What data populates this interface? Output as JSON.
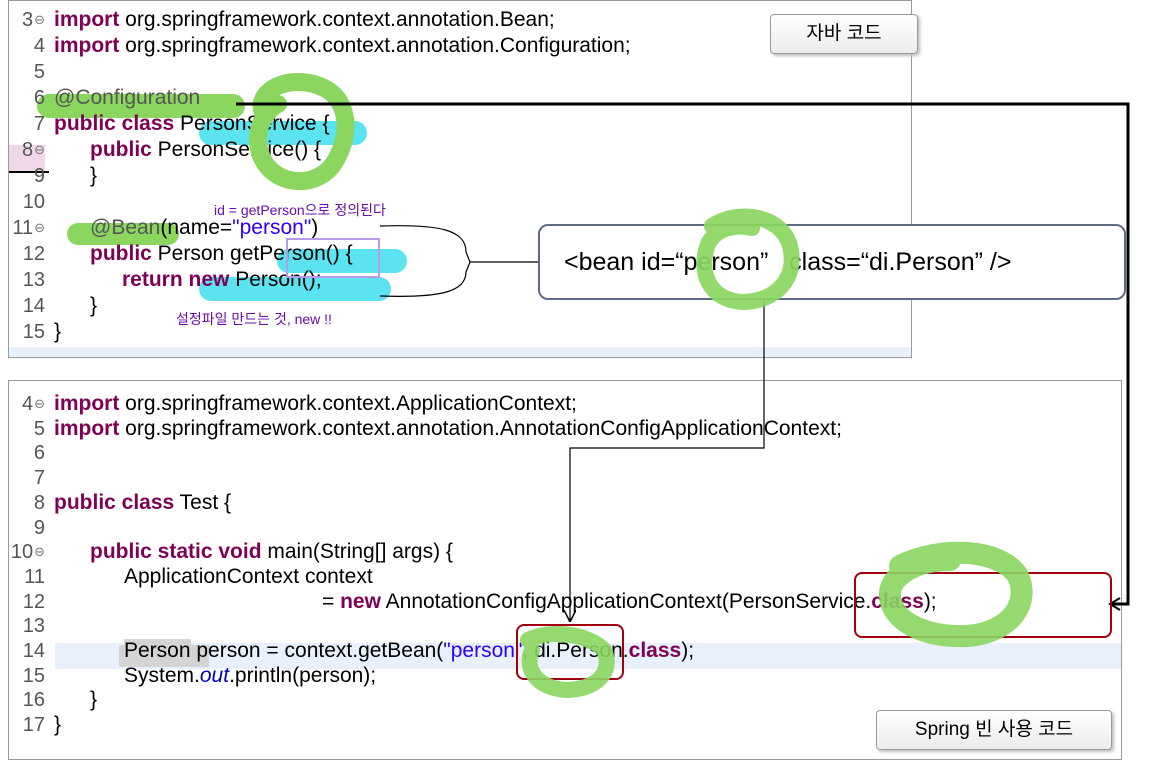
{
  "top_code": {
    "lines": [
      {
        "no": "3",
        "fold": true,
        "kw": "import",
        "rest": " org.springframework.context.annotation.Bean;"
      },
      {
        "no": "4",
        "fold": false,
        "kw": "import",
        "rest": " org.springframework.context.annotation.Configuration;"
      },
      {
        "no": "5",
        "fold": false
      },
      {
        "no": "6",
        "fold": false,
        "ann": "@Configuration"
      },
      {
        "no": "7",
        "fold": false,
        "kw": "public class",
        "rest": " PersonService {"
      },
      {
        "no": "8",
        "fold": true,
        "kw": "public",
        "rest": " PersonService() {"
      },
      {
        "no": "9",
        "fold": false,
        "rest": "}"
      },
      {
        "no": "10",
        "fold": false
      },
      {
        "no": "11",
        "fold": true,
        "ann": "@Bean",
        "rest": "(name=",
        "str": "\"person\"",
        "tail": ")"
      },
      {
        "no": "12",
        "fold": false,
        "kw": "public",
        "rest": " Person getPerson() {"
      },
      {
        "no": "13",
        "fold": false,
        "kw": "return new",
        "rest": " Person();"
      },
      {
        "no": "14",
        "fold": false,
        "rest": "}"
      },
      {
        "no": "15",
        "fold": false,
        "rest": "}"
      }
    ]
  },
  "bottom_code": {
    "lines": [
      {
        "no": "4",
        "fold": true,
        "kw": "import",
        "rest": " org.springframework.context.ApplicationContext;"
      },
      {
        "no": "5",
        "fold": false,
        "kw": "import",
        "rest": " org.springframework.context.annotation.AnnotationConfigApplicationContext;"
      },
      {
        "no": "6",
        "fold": false
      },
      {
        "no": "7",
        "fold": false
      },
      {
        "no": "8",
        "fold": false,
        "kw": "public class",
        "rest": " Test {"
      },
      {
        "no": "9",
        "fold": false
      },
      {
        "no": "10",
        "fold": true,
        "kw": "public static void",
        "rest": " main(String[] args) {"
      },
      {
        "no": "11",
        "fold": false,
        "rest": "ApplicationContext context"
      },
      {
        "no": "12",
        "fold": false,
        "pre": "= ",
        "kw": "new",
        "rest": " AnnotationConfigApplicationContext(PersonService.",
        "kw2": "class",
        "tail": ");"
      },
      {
        "no": "13",
        "fold": false
      },
      {
        "no": "14",
        "fold": false,
        "gray": "Person",
        "rest": " person = context.getBean(",
        "str": "\"person\"",
        "rest2": ", di.Person.",
        "kw2": "class",
        "tail": ");"
      },
      {
        "no": "15",
        "fold": false,
        "rest": "System.",
        "static": "out",
        "tail": ".println(person);"
      },
      {
        "no": "16",
        "fold": false,
        "rest": "}"
      },
      {
        "no": "17",
        "fold": false,
        "rest": "}"
      }
    ]
  },
  "labels": {
    "java_code": "자바 코드",
    "spring_code": "Spring 빈 사용 코드",
    "note_id": "id = getPerson으로 정의된다",
    "note_config": "설정파일 만드는 것, new !!",
    "bean_xml_prefix": "<bean id=",
    "bean_xml_id": "“person”",
    "bean_xml_suffix": "   class=“di.Person” />"
  },
  "colors": {
    "highlight_cyan": "#5be3ef",
    "highlight_green": "#8ad65f",
    "box_red": "#a3000f",
    "box_purple": "#b89be8",
    "keyword": "#7f0055",
    "string": "#2a00ff"
  }
}
